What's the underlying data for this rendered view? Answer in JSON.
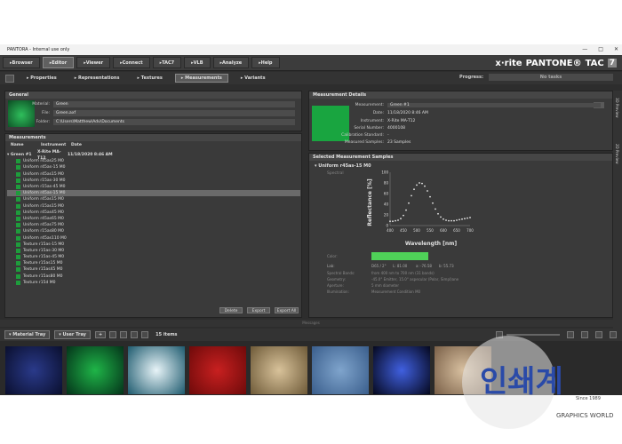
{
  "window": {
    "title": "PANTORA - Internal use only",
    "buttons": [
      "—",
      "□",
      "✕"
    ]
  },
  "topnav": {
    "items": [
      {
        "label": "Browser",
        "active": false
      },
      {
        "label": "Editor",
        "active": true
      },
      {
        "label": "Viewer",
        "active": false
      },
      {
        "label": "Connect",
        "active": false
      },
      {
        "label": "TAC7",
        "active": false
      },
      {
        "label": "VLB",
        "active": false
      },
      {
        "label": "Analyze",
        "active": false
      },
      {
        "label": "Help",
        "active": false
      }
    ],
    "brand": {
      "xrite": "x·rite",
      "pantone": "PANTONE®",
      "tac": "TAC",
      "tac_num": "7"
    }
  },
  "subnav": {
    "items": [
      {
        "label": "Properties",
        "active": false
      },
      {
        "label": "Representations",
        "active": false
      },
      {
        "label": "Textures",
        "active": false
      },
      {
        "label": "Measurements",
        "active": true
      },
      {
        "label": "Variants",
        "active": false
      }
    ],
    "progress_label": "Progress:",
    "progress_text": "No tasks"
  },
  "general": {
    "header": "General",
    "material_label": "Material:",
    "material_value": "Green",
    "file_label": "File:",
    "file_value": "Green.axf",
    "folder_label": "Folder:",
    "folder_value": "C:\\Users\\Matthew\\Adv\\Documents",
    "swatch_color": "#1a8f3a"
  },
  "measurements": {
    "header": "Measurements",
    "col_name": "Name",
    "col_instrument": "Instrument",
    "col_date": "Date",
    "group": {
      "name": "Green #1",
      "instrument": "X-Rite MA-T12",
      "date": "11/18/2020 8:46 AM"
    },
    "rows": [
      "Uniform r45as25 M0",
      "Uniform r45as-15 M0",
      "Uniform r45as15 M0",
      "Uniform r15as-30 M0",
      "Uniform r15as-45 M0",
      "Uniform r45as-15 M0",
      "Uniform r45as15 M0",
      "Uniform r15as15 M0",
      "Uniform r45as45 M0",
      "Uniform r45as65 M0",
      "Uniform r45as75 M0",
      "Uniform r15as80 M0",
      "Uniform r45as110 M0",
      "Texture r15as-15 M0",
      "Texture r15as-30 M0",
      "Texture r15as-45 M0",
      "Texture r15as15 M0",
      "Texture r15as45 M0",
      "Texture r15as80 M0",
      "Texture r15d M0"
    ],
    "selected_index": 5,
    "buttons": {
      "delete": "Delete",
      "export": "Export",
      "export_all": "Export All"
    }
  },
  "details": {
    "header": "Measurement Details",
    "swatch_color": "#19a540",
    "measurement_label": "Measurement:",
    "measurement_value": "Green #1",
    "date_label": "Date:",
    "date_value": "11/18/2020 8:46 AM",
    "instrument_label": "Instrument:",
    "instrument_value": "X-Rite MA-T12",
    "serial_label": "Serial Number:",
    "serial_value": "4000108",
    "calib_label": "Calibration Standard:",
    "calib_value": "-",
    "samples_label": "Measured Samples:",
    "samples_value": "23 Samples"
  },
  "samples": {
    "header": "Selected Measurement Samples",
    "item_title": "Uniform r45as-15 M0",
    "spectral_label": "Spectral",
    "color_label": "Color:",
    "color_swatch": "#4fd058",
    "lab_label": "Lab:",
    "lab_illum": "D65 / 2°",
    "lab_l": "L: 81.00",
    "lab_a": "a: -76.58",
    "lab_b": "b: 55.73",
    "spectral_bands_label": "Spectral Bands:",
    "spectral_bands_value": "from 400 nm to 700 nm (31 bands)",
    "geometry_label": "Geometry:",
    "geometry_value": "-45.0° Emitter, 15.0° aspecular (Polar, Simpl)ane",
    "aperture_label": "Aperture:",
    "aperture_value": "5 mm diameter",
    "illumination_label": "Illumination:",
    "illumination_value": "Measurement Condition M0"
  },
  "chart_data": {
    "type": "scatter",
    "xlabel": "Wavelength [nm]",
    "ylabel": "Reflectance [%]",
    "xlim": [
      400,
      700
    ],
    "ylim": [
      0,
      100
    ],
    "x_ticks": [
      400,
      450,
      500,
      550,
      600,
      650,
      700
    ],
    "y_ticks": [
      0,
      20,
      40,
      60,
      80,
      100
    ],
    "series": [
      {
        "x": [
          400,
          410,
          420,
          430,
          440,
          450,
          460,
          470,
          480,
          490,
          500,
          510,
          520,
          530,
          540,
          550,
          560,
          570,
          580,
          590,
          600,
          610,
          620,
          630,
          640,
          650,
          660,
          670,
          680,
          690,
          700
        ],
        "y": [
          8,
          8,
          9,
          10,
          13,
          19,
          29,
          42,
          56,
          68,
          76,
          80,
          79,
          74,
          65,
          54,
          42,
          31,
          22,
          16,
          12,
          10,
          9,
          9,
          9,
          10,
          11,
          12,
          13,
          14,
          15
        ]
      }
    ]
  },
  "sidetabs": [
    "3D Preview",
    "2D Preview"
  ],
  "divider_label": "Messages",
  "tray": {
    "material_tray": "Material Tray",
    "user_tray": "User Tray",
    "count": "15 items",
    "thumbs": [
      {
        "c1": "#2a3a8a",
        "c2": "#0a0f2e"
      },
      {
        "c1": "#1fb548",
        "c2": "#04331a"
      },
      {
        "c1": "#e8f4f8",
        "c2": "#1d5a6e"
      },
      {
        "c1": "#c82020",
        "c2": "#6e0a0a"
      },
      {
        "c1": "#d8c29a",
        "c2": "#6e5a38"
      },
      {
        "c1": "#7fa4cc",
        "c2": "#3a5e8c"
      },
      {
        "c1": "#4060e0",
        "c2": "#05081e"
      },
      {
        "c1": "#d8c0a0",
        "c2": "#7a6048"
      }
    ]
  },
  "watermark": {
    "logo_text": "인쇄계",
    "since": "Since 1989",
    "subtitle": "GRAPHICS WORLD"
  }
}
